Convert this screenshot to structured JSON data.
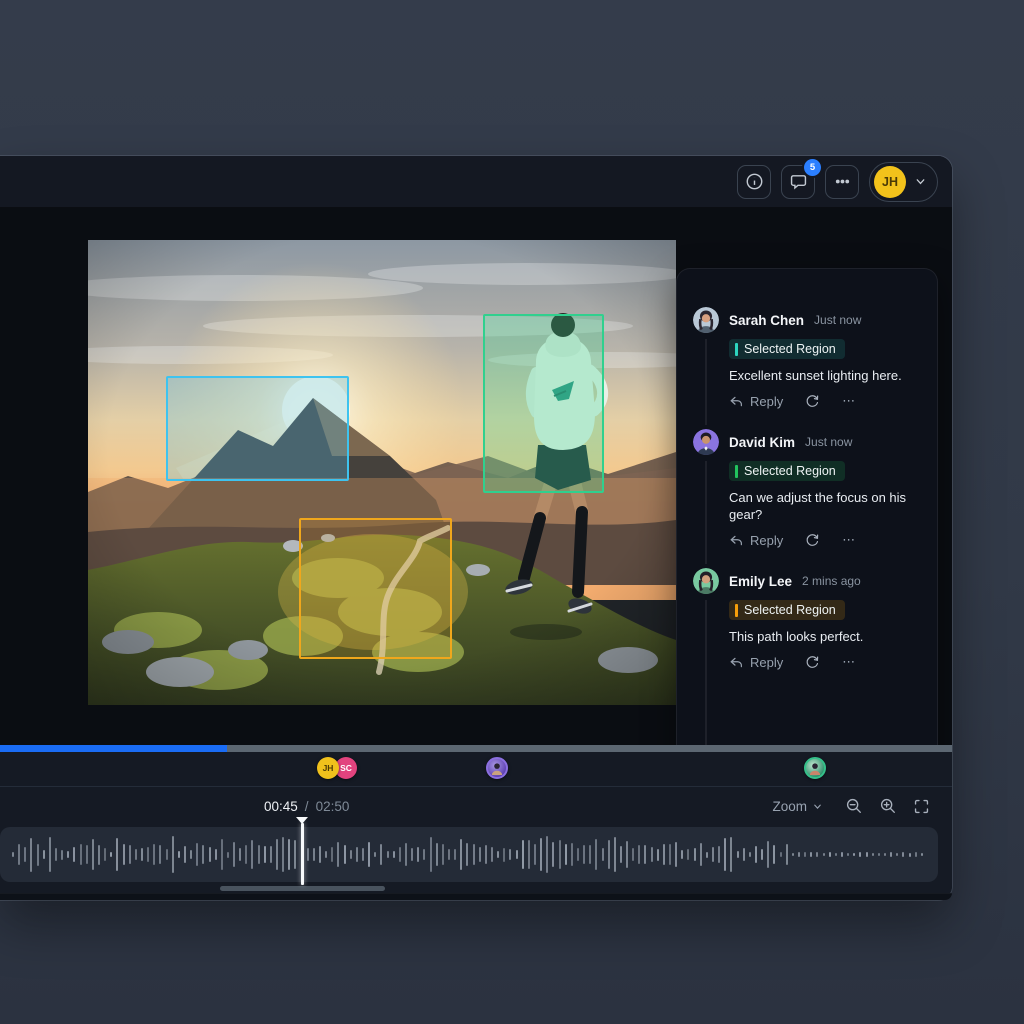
{
  "colors": {
    "accent_blue": "#1a6cf5",
    "badge_blue": "#2b7fff",
    "tag_teal": "#2dd4bf",
    "tag_green": "#22c55e",
    "tag_orange": "#f59e0b",
    "annotation_cyan": "#3ec3ef",
    "annotation_green": "#30d08e",
    "annotation_orange": "#f0a71c",
    "user_yellow": "#f2c21b"
  },
  "toolbar": {
    "comment_badge": "5",
    "user_initials": "JH"
  },
  "viewer": {
    "annotations": [
      {
        "name": "sky-region",
        "color": "#3ec3ef"
      },
      {
        "name": "runner-region",
        "color": "#30d08e"
      },
      {
        "name": "path-region",
        "color": "#f0a71c"
      }
    ]
  },
  "comments": {
    "items": [
      {
        "author": "Sarah Chen",
        "timestamp": "Just now",
        "tag": "Selected Region",
        "text": "Excellent sunset lighting here.",
        "reply": "Reply"
      },
      {
        "author": "David Kim",
        "timestamp": "Just now",
        "tag": "Selected Region",
        "text": "Can we adjust the focus on his gear?",
        "reply": "Reply"
      },
      {
        "author": "Emily Lee",
        "timestamp": "2 mins ago",
        "tag": "Selected Region",
        "text": "This path looks perfect.",
        "reply": "Reply"
      }
    ]
  },
  "player": {
    "current_time": "00:45",
    "time_separator": "/",
    "total_time": "02:50",
    "zoom_label": "Zoom",
    "progress_percent": 23.8
  },
  "timeline": {
    "markers": [
      {
        "label": "JH",
        "color": "#f0c11c"
      },
      {
        "label": "SC",
        "color": "#e2437e"
      },
      {
        "label": "",
        "color": "#5c3fb0"
      },
      {
        "label": "",
        "color": "#2e8f6b"
      }
    ]
  }
}
